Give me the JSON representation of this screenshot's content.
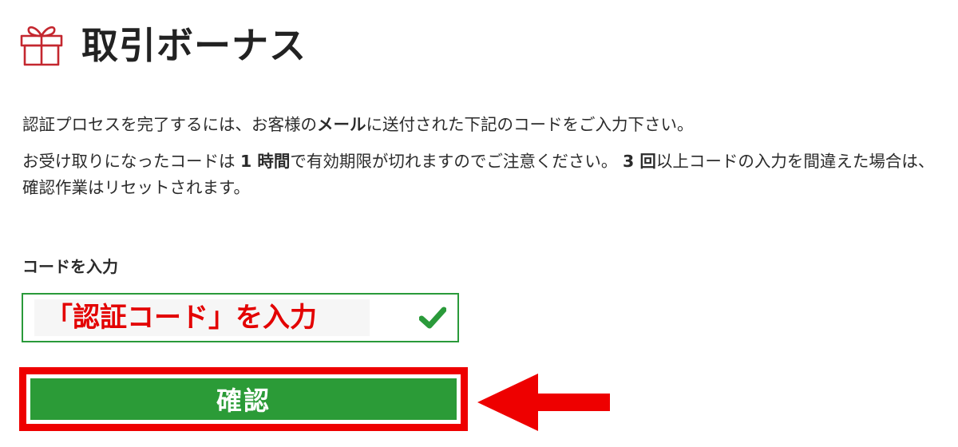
{
  "header": {
    "title": "取引ボーナス",
    "icon": "gift-icon",
    "icon_color": "#c4272f"
  },
  "instructions": {
    "p1": {
      "before": "認証プロセスを完了するには、お客様の",
      "bold": "メール",
      "after": "に送付された下記のコードをご入力下さい。"
    },
    "p2": {
      "t1": "お受け取りになったコードは ",
      "b1": "1 時間",
      "t2": "で有効期限が切れますのでご注意ください。 ",
      "b2": "3 回",
      "t3": "以上コードの入力を間違えた場合は、確認作業はリセットされます。"
    }
  },
  "form": {
    "code_label": "コードを入力",
    "code_placeholder": "「認証コード」を入力",
    "check_icon": "check-icon",
    "check_color": "#2a9a3a",
    "confirm_label": "確認",
    "confirm_color": "#2b9b37"
  },
  "annotation": {
    "highlight_color": "#ee0000",
    "arrow_icon": "left-arrow-icon"
  }
}
